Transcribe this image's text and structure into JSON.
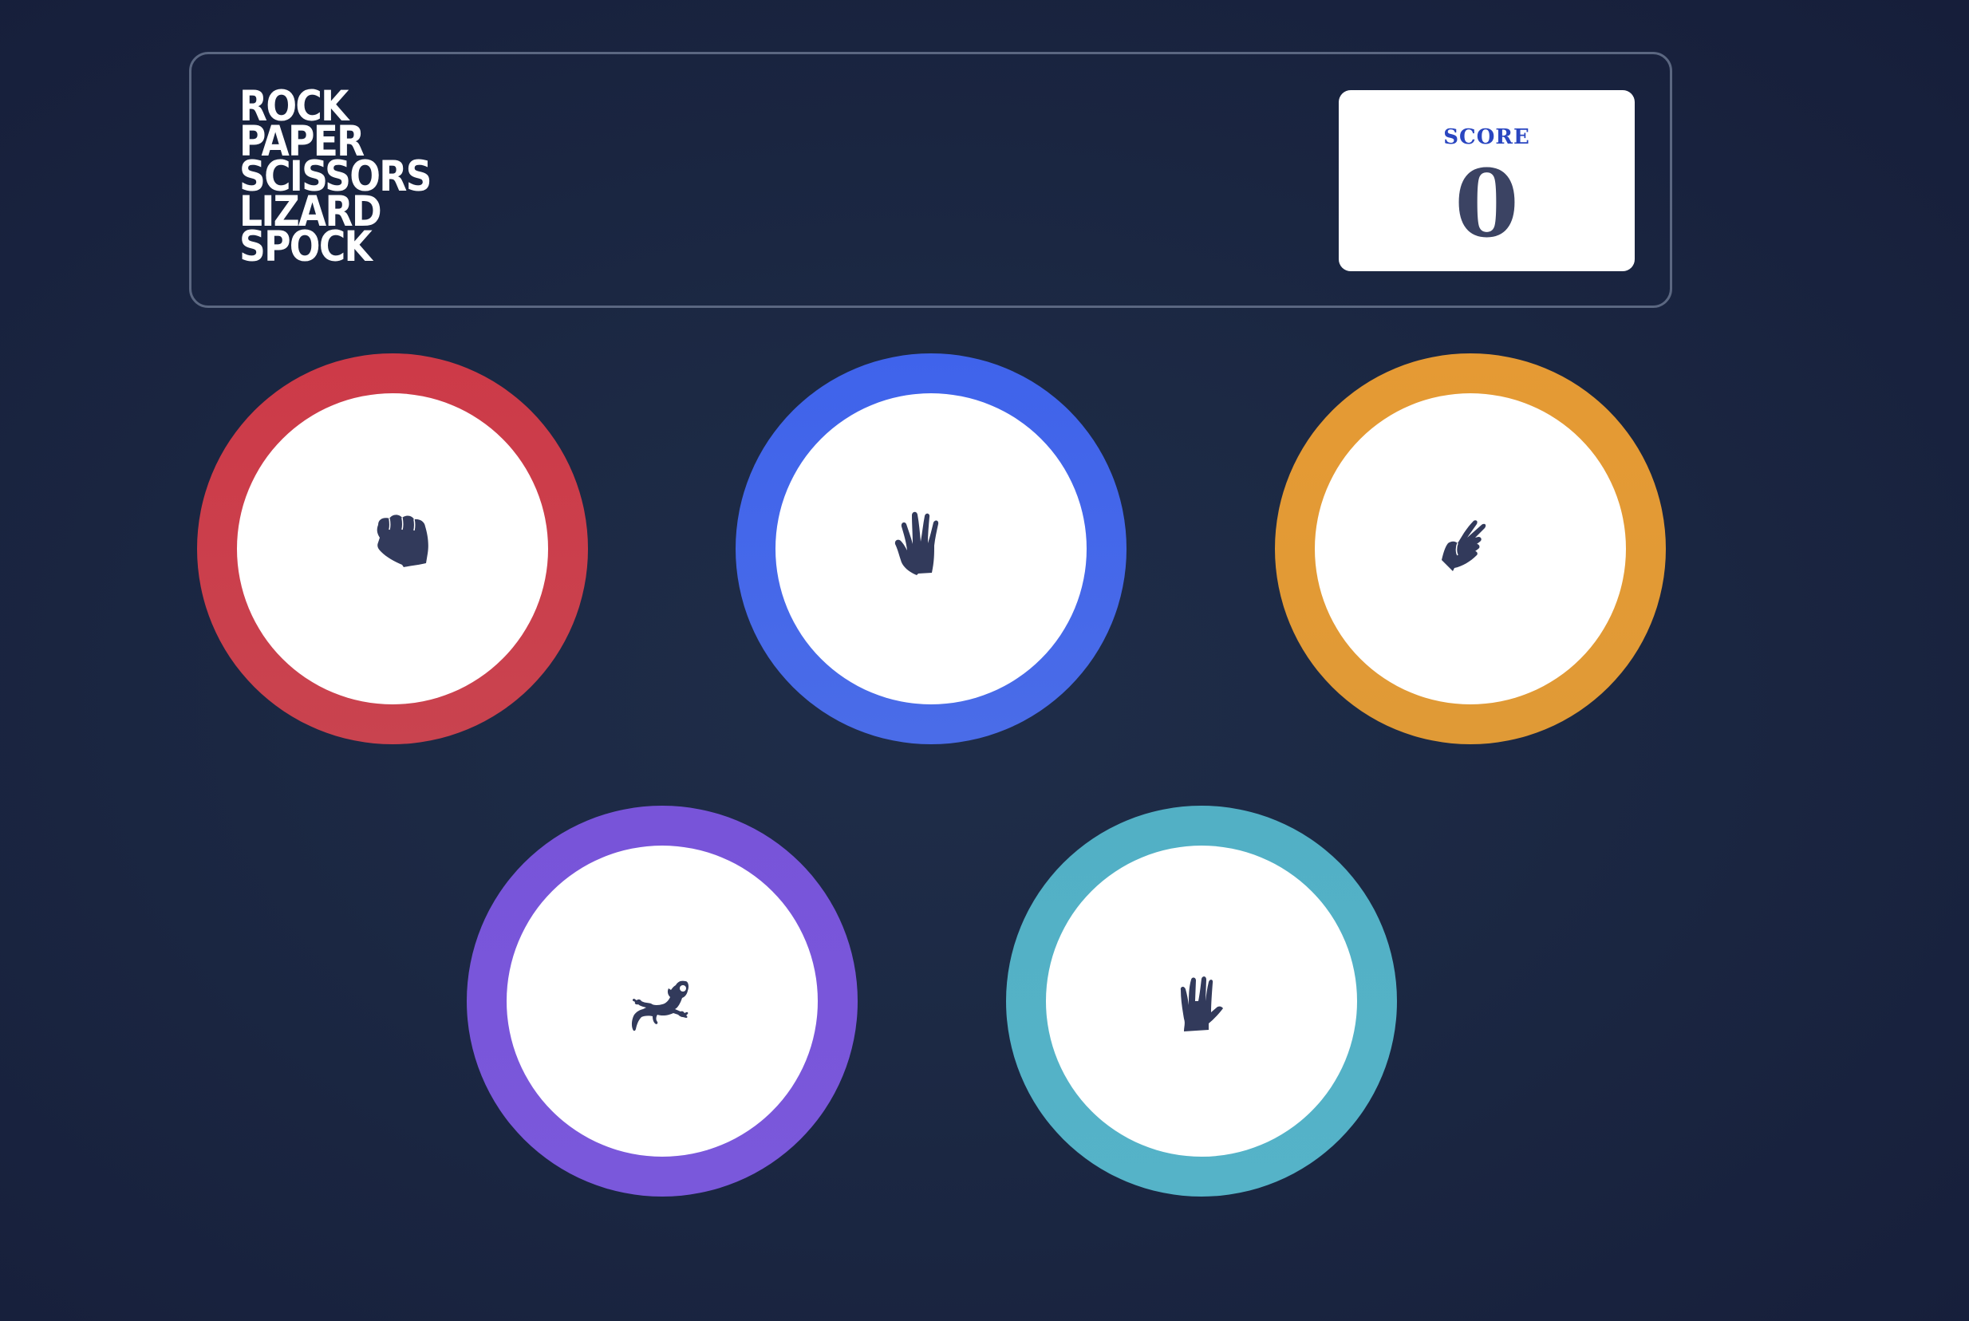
{
  "title_lines": [
    "ROCK",
    "PAPER",
    "SCISSORS",
    "LIZARD",
    "SPOCK"
  ],
  "score": {
    "label": "SCORE",
    "value": "0"
  },
  "choices": [
    {
      "id": "rock",
      "icon": "rock-fist-icon",
      "color": "#cd3a48"
    },
    {
      "id": "paper",
      "icon": "paper-hand-icon",
      "color": "#3f63eb"
    },
    {
      "id": "scissors",
      "icon": "scissors-hand-icon",
      "color": "#e59a34"
    },
    {
      "id": "lizard",
      "icon": "lizard-icon",
      "color": "#7854d9"
    },
    {
      "id": "spock",
      "icon": "spock-hand-icon",
      "color": "#52b0c5"
    }
  ]
}
